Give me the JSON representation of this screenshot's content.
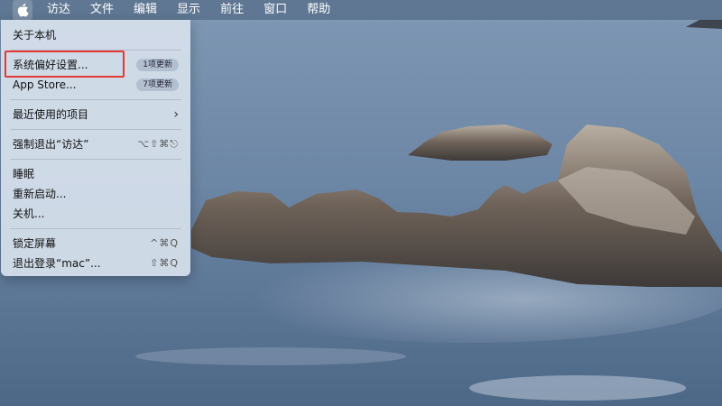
{
  "menubar": {
    "items": [
      "访达",
      "文件",
      "编辑",
      "显示",
      "前往",
      "窗口",
      "帮助"
    ]
  },
  "apple_menu": {
    "about": "关于本机",
    "system_prefs": "系统偏好设置...",
    "system_prefs_badge": "1项更新",
    "app_store": "App Store...",
    "app_store_badge": "7项更新",
    "recent_items": "最近使用的项目",
    "force_quit": "强制退出“访达”",
    "force_quit_shortcut": "⌥⇧⌘⎋",
    "sleep": "睡眠",
    "restart": "重新启动...",
    "shutdown": "关机...",
    "lock_screen": "锁定屏幕",
    "lock_screen_shortcut": "^⌘Q",
    "logout": "退出登录“mac”...",
    "logout_shortcut": "⇧⌘Q"
  },
  "colors": {
    "highlight": "#e53935"
  }
}
